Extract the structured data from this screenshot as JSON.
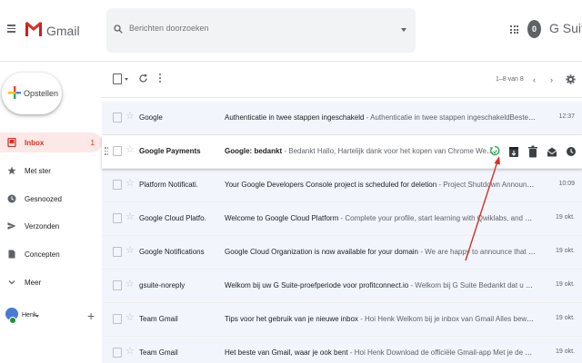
{
  "header": {
    "app_name": "Gmail",
    "search_placeholder": "Berichten doorzoeken",
    "account_initial": "0",
    "gsuite_label": "G Suite"
  },
  "compose": {
    "label": "Opstellen"
  },
  "sidebar": {
    "items": [
      {
        "label": "Inbox",
        "count": "1",
        "icon": "inbox-icon",
        "active": true
      },
      {
        "label": "Met ster",
        "icon": "star-icon"
      },
      {
        "label": "Gesnoozed",
        "icon": "clock-icon"
      },
      {
        "label": "Verzonden",
        "icon": "send-icon"
      },
      {
        "label": "Concepten",
        "icon": "draft-icon"
      },
      {
        "label": "Meer",
        "icon": "chevron-down-icon"
      }
    ],
    "hangouts_user": "Henk"
  },
  "toolbar": {
    "pager": "1–8 van 8",
    "prev": "‹",
    "next": "›"
  },
  "emails": [
    {
      "sender": "Google",
      "subject": "Authenticatie in twee stappen ingeschakeld",
      "snippet": " - Authenticatie in twee stappen ingeschakeldBeste Henk,Je hebt authenticatie in twee stappen",
      "date": "12:37"
    },
    {
      "sender": "Google Payments",
      "subject": "Google: bedankt",
      "snippet": " - Bedankt Hallo, Hartelijk dank voor het kopen van Chrome Web Store in de Chrome",
      "date": "",
      "hover": true
    },
    {
      "sender": "Platform Notificati.",
      "subject": "Your Google Developers Console project is scheduled for deletion",
      "snippet": " - Project Shutdown Announcement Your Google",
      "date": "10:09"
    },
    {
      "sender": "Google Cloud Platfo.",
      "subject": "Welcome to Google Cloud Platform",
      "snippet": " - Complete your profile, start learning with Qwiklabs, and get up and running",
      "date": "19 okt."
    },
    {
      "sender": "Google Notifications",
      "subject": "Google Cloud Organization is now available for your domain",
      "snippet": " - We are happy to announce that the Cloud Organization",
      "date": "19 okt."
    },
    {
      "sender": "gsuite-noreply",
      "subject": "Welkom bij uw G Suite-proefperiode voor profitconnect.io",
      "snippet": " - Welkom bij G Suite Bedankt dat u aan de slag bent gegaan",
      "date": "19 okt."
    },
    {
      "sender": "Team Gmail",
      "subject": "Tips voor het gebruik van je nieuwe inbox",
      "snippet": " - Hoi Henk Welkom bij je inbox van Gmail Alles bewaren Je krijgt zo veel",
      "date": "19 okt."
    },
    {
      "sender": "Team Gmail",
      "subject": "Het beste van Gmail, waar je ook bent",
      "snippet": " - Hoi Henk Download de officiële Gmail-app Met je de officiële Gmail-app",
      "date": "19 okt."
    }
  ],
  "colors": {
    "accent": "#d93025",
    "arrow": "#d93025",
    "hover_icon": "#34a853"
  }
}
